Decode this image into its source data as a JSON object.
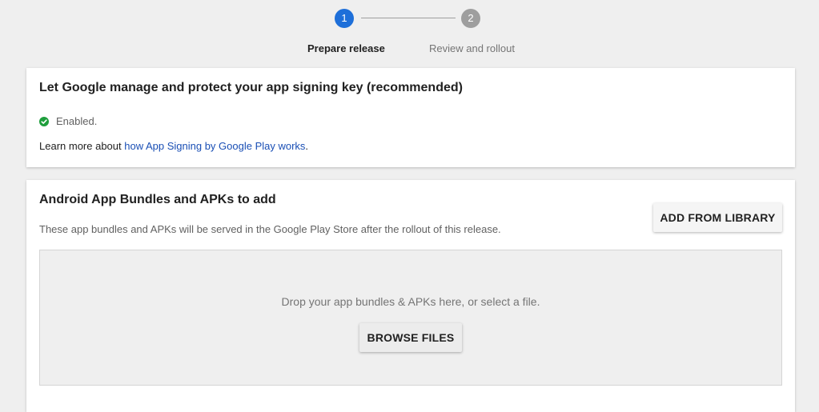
{
  "stepper": {
    "steps": [
      {
        "number": "1",
        "label": "Prepare release",
        "state": "active"
      },
      {
        "number": "2",
        "label": "Review and rollout",
        "state": "inactive"
      }
    ],
    "active_color": "#1e6fd9",
    "inactive_color": "#9e9e9e"
  },
  "signing": {
    "title": "Let Google manage and protect your app signing key (recommended)",
    "status": "Enabled.",
    "status_icon": "check-circle-icon",
    "learn_prefix": "Learn more about ",
    "learn_link": "how App Signing by Google Play works",
    "learn_suffix": "."
  },
  "bundles": {
    "title": "Android App Bundles and APKs to add",
    "description": "These app bundles and APKs will be served in the Google Play Store after the rollout of this release.",
    "add_button": "ADD FROM LIBRARY",
    "drop_text": "Drop your app bundles & APKs here, or select a file.",
    "browse_button": "BROWSE FILES"
  }
}
